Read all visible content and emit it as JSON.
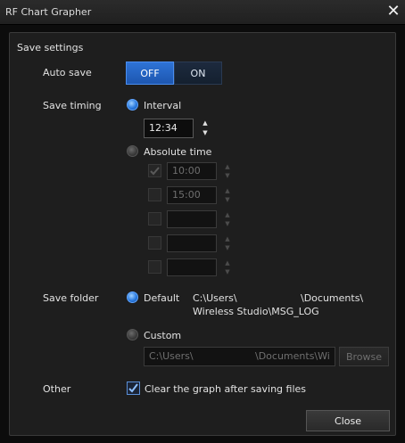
{
  "window": {
    "title": "RF Chart Grapher",
    "close_glyph": "✕"
  },
  "section": {
    "title": "Save settings"
  },
  "auto_save": {
    "label": "Auto save",
    "off_label": "OFF",
    "on_label": "ON",
    "selected": "OFF"
  },
  "save_timing": {
    "label": "Save timing",
    "interval_label": "Interval",
    "interval_value": "12:34",
    "interval_selected": true,
    "absolute_label": "Absolute  time",
    "absolute_times": [
      {
        "checked": true,
        "value": "10:00"
      },
      {
        "checked": false,
        "value": "15:00"
      },
      {
        "checked": false,
        "value": ""
      },
      {
        "checked": false,
        "value": ""
      },
      {
        "checked": false,
        "value": ""
      }
    ]
  },
  "save_folder": {
    "label": "Save folder",
    "default_label": "Default",
    "default_path_line1_a": "C:\\Users\\",
    "default_path_line1_b": "\\Documents\\",
    "default_path_line2": "Wireless Studio\\MSG_LOG",
    "default_selected": true,
    "custom_label": "Custom",
    "custom_path_a": "C:\\Users\\",
    "custom_path_b": "\\Documents\\Wi",
    "browse_label": "Browse"
  },
  "other": {
    "label": "Other",
    "clear_label": "Clear the graph after saving files",
    "clear_checked": true
  },
  "footer": {
    "close_label": "Close"
  },
  "icons": {
    "close": "close-icon",
    "spin_up": "chevron-up-icon",
    "spin_down": "chevron-down-icon",
    "check": "check-icon"
  },
  "colors": {
    "accent": "#2e73d6",
    "background": "#1e1e1e",
    "titlebar": "#242424"
  }
}
